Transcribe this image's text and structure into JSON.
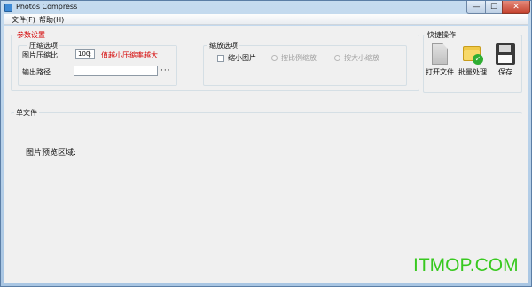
{
  "window": {
    "title": "Photos Compress",
    "minimize_glyph": "—",
    "maximize_glyph": "☐",
    "close_glyph": "✕"
  },
  "menu": {
    "file": "文件(F)",
    "help": "帮助(H)"
  },
  "params": {
    "group_title": "参数设置",
    "compress": {
      "group_title": "压缩选项",
      "ratio_label": "图片压缩比",
      "ratio_value": "100",
      "hint": "值越小压缩率越大",
      "path_label": "输出路径",
      "path_value": "",
      "browse_label": "···"
    },
    "zoom": {
      "group_title": "缩放选项",
      "shrink_label": "缩小图片",
      "shrink_checked": false,
      "ratio_option": "按比例缩放",
      "max_option": "按大小缩放"
    }
  },
  "quick": {
    "group_title": "快捷操作",
    "open_label": "打开文件",
    "batch_label": "批量处理",
    "save_label": "保存",
    "check_glyph": "✓",
    "icons": [
      "document-icon",
      "folder-check-icon",
      "floppy-save-icon"
    ]
  },
  "single": {
    "group_title": "单文件",
    "preview_label": "图片预览区域:"
  },
  "watermark": "ITMOP.COM",
  "colors": {
    "accent_red": "#d40000",
    "watermark_green": "#38c91f",
    "check_green": "#2fae33"
  }
}
